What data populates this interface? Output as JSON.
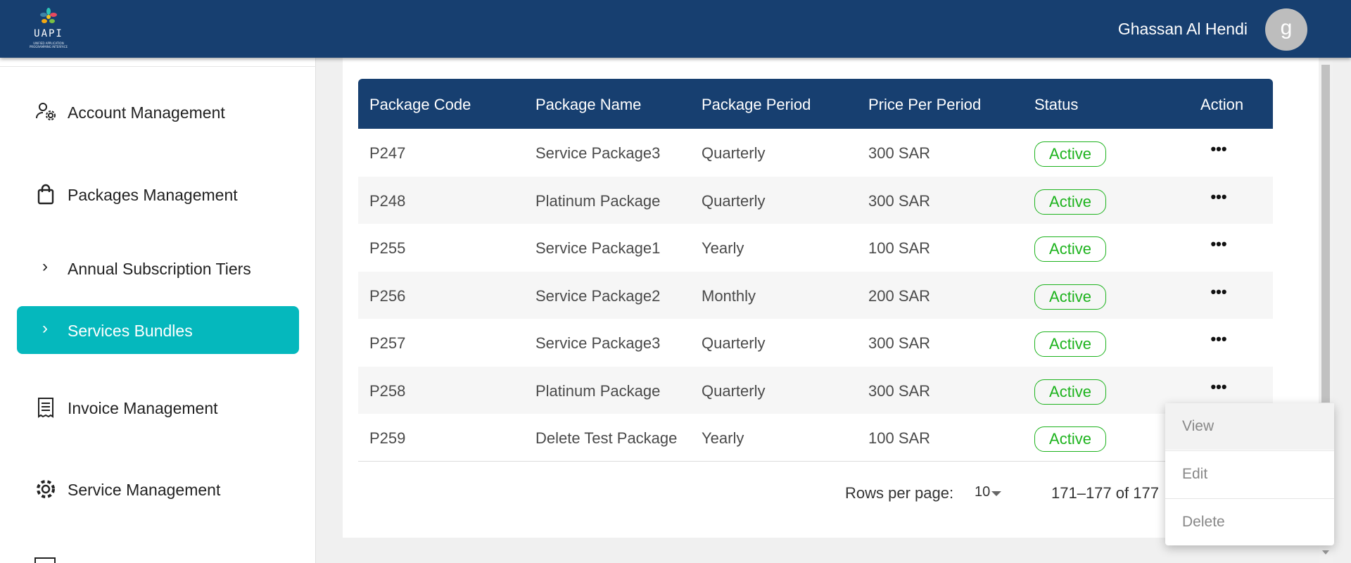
{
  "header": {
    "logo_text": "UAPI",
    "logo_subtext": "UNIFIED APPLICATION PROGRAMMING INTERFACE",
    "username": "Ghassan Al Hendi",
    "avatar_letter": "g",
    "bar_color": "#173f70"
  },
  "sidebar": {
    "items": [
      {
        "label": "Account Management",
        "icon": "user-gear-icon",
        "active": false
      },
      {
        "label": "Packages Management",
        "icon": "shopping-bag-icon",
        "active": false
      },
      {
        "label": "Annual Subscription Tiers",
        "icon": "chevron-right-icon",
        "active": false
      },
      {
        "label": "Services Bundles",
        "icon": "chevron-right-icon",
        "active": true
      },
      {
        "label": "Invoice Management",
        "icon": "receipt-icon",
        "active": false
      },
      {
        "label": "Service Management",
        "icon": "gear-icon",
        "active": false
      }
    ],
    "active_color": "#05b8bd"
  },
  "table": {
    "headers": [
      "Package Code",
      "Package Name",
      "Package Period",
      "Price Per Period",
      "Status",
      "Action"
    ],
    "rows": [
      {
        "code": "P247",
        "name": "Service Package3",
        "period": "Quarterly",
        "price": "300 SAR",
        "status": "Active"
      },
      {
        "code": "P248",
        "name": "Platinum Package",
        "period": "Quarterly",
        "price": "300 SAR",
        "status": "Active"
      },
      {
        "code": "P255",
        "name": "Service Package1",
        "period": "Yearly",
        "price": "100 SAR",
        "status": "Active"
      },
      {
        "code": "P256",
        "name": "Service Package2",
        "period": "Monthly",
        "price": "200 SAR",
        "status": "Active"
      },
      {
        "code": "P257",
        "name": "Service Package3",
        "period": "Quarterly",
        "price": "300 SAR",
        "status": "Active"
      },
      {
        "code": "P258",
        "name": "Platinum Package",
        "period": "Quarterly",
        "price": "300 SAR",
        "status": "Active"
      },
      {
        "code": "P259",
        "name": "Delete Test Package",
        "period": "Yearly",
        "price": "100 SAR",
        "status": "Active"
      }
    ],
    "action_glyph": "•••",
    "status_color": "#1db31d"
  },
  "pagination": {
    "rows_per_page_label": "Rows per page:",
    "rows_per_page_value": "10",
    "range_text": "171–177 of 177",
    "prev_icon": "chevron-left-icon",
    "next_icon": "chevron-right-icon"
  },
  "action_menu": {
    "items": [
      "View",
      "Edit",
      "Delete"
    ]
  }
}
